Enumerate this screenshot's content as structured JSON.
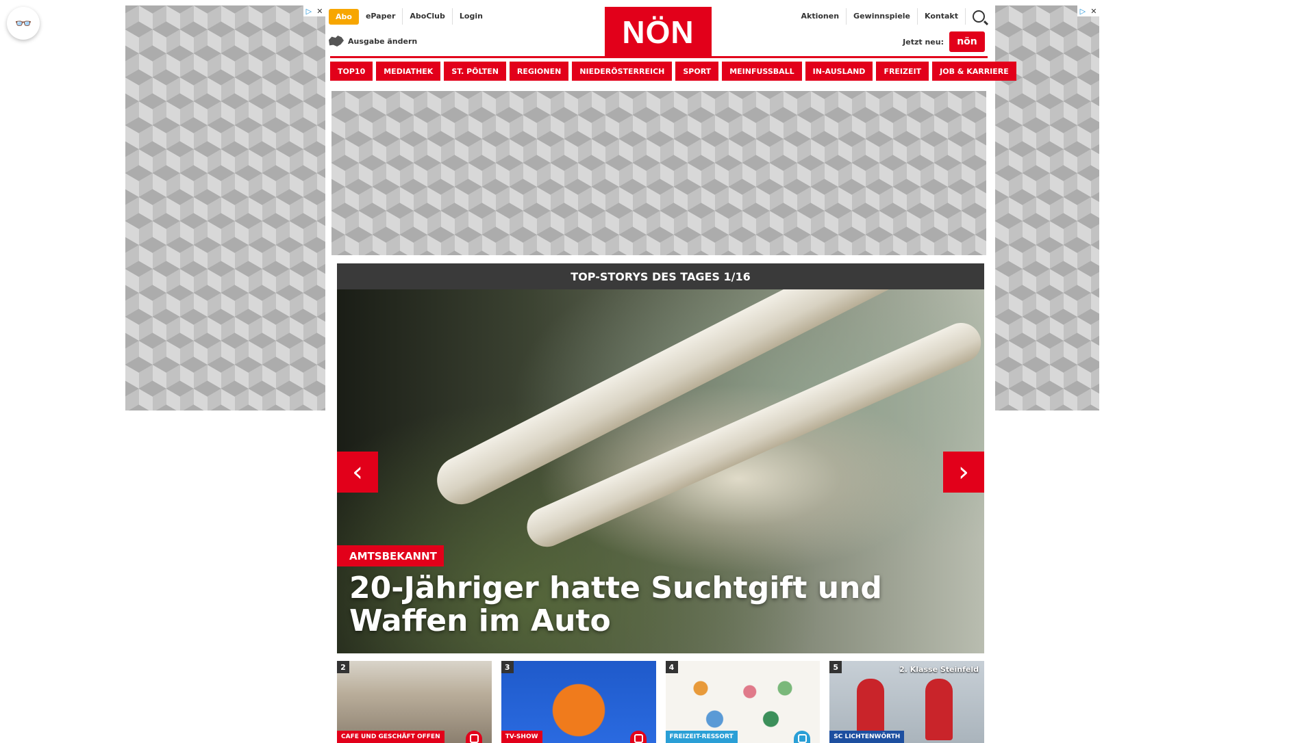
{
  "utility": {
    "eye_icon_glyph": "👓"
  },
  "ads": {
    "choice_glyph": "▷",
    "close_glyph": "✕"
  },
  "header": {
    "abo": "Abo",
    "left_links": [
      "ePaper",
      "AboClub",
      "Login"
    ],
    "ausgabe": "Ausgabe ändern",
    "logo": "NÖN",
    "right_links": [
      "Aktionen",
      "Gewinnspiele",
      "Kontakt"
    ],
    "jetzt_neu": "Jetzt neu:",
    "neu_badge": "nön",
    "accent_color": "#e2001a",
    "abo_color": "#f7a600"
  },
  "nav": {
    "items": [
      "TOP10",
      "MEDIATHEK",
      "ST. PÖLTEN",
      "REGIONEN",
      "NIEDERÖSTERREICH",
      "SPORT",
      "MEINFUSSBALL",
      "IN-AUSLAND",
      "FREIZEIT",
      "JOB & KARRIERE"
    ]
  },
  "stories": {
    "header": "TOP-STORYS DES TAGES 1/16",
    "prev_glyph": "‹",
    "next_glyph": "›",
    "hero": {
      "tag": "AMTSBEKANNT",
      "title": "20-Jähriger hatte Suchtgift und Waffen im Auto"
    },
    "thumbs": [
      {
        "num": "2",
        "category": "CAFE UND GESCHÄFT OFFEN",
        "cat_color": "#e2001a",
        "camera": true
      },
      {
        "num": "3",
        "category": "TV-SHOW",
        "cat_color": "#e2001a",
        "camera": true
      },
      {
        "num": "4",
        "category": "FREIZEIT-RESSORT",
        "cat_color": "#2a9fd6",
        "camera": true
      },
      {
        "num": "5",
        "category": "SC LICHTENWÖRTH",
        "cat_color": "#1d4fa0",
        "camera": false,
        "overlay": "2. Klasse Steinfeld"
      }
    ]
  }
}
